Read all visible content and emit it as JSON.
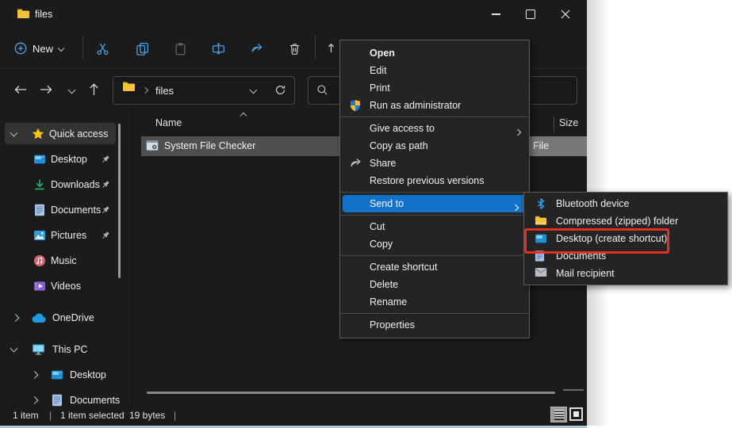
{
  "window": {
    "title": "files"
  },
  "toolbar": {
    "new_label": "New"
  },
  "addressbar": {
    "path_segment": "files"
  },
  "list": {
    "columns": {
      "name": "Name",
      "size": "Size"
    },
    "row": {
      "name": "System File Checker",
      "type": "File"
    }
  },
  "sidebar": {
    "items": [
      {
        "label": "Quick access"
      },
      {
        "label": "Desktop"
      },
      {
        "label": "Downloads"
      },
      {
        "label": "Documents"
      },
      {
        "label": "Pictures"
      },
      {
        "label": "Music"
      },
      {
        "label": "Videos"
      },
      {
        "label": "OneDrive"
      },
      {
        "label": "This PC"
      },
      {
        "label": "Desktop"
      },
      {
        "label": "Documents"
      }
    ]
  },
  "context_menu": {
    "items": [
      {
        "label": "Open"
      },
      {
        "label": "Edit"
      },
      {
        "label": "Print"
      },
      {
        "label": "Run as administrator"
      },
      {
        "label": "Give access to"
      },
      {
        "label": "Copy as path"
      },
      {
        "label": "Share"
      },
      {
        "label": "Restore previous versions"
      },
      {
        "label": "Send to"
      },
      {
        "label": "Cut"
      },
      {
        "label": "Copy"
      },
      {
        "label": "Create shortcut"
      },
      {
        "label": "Delete"
      },
      {
        "label": "Rename"
      },
      {
        "label": "Properties"
      }
    ]
  },
  "send_to_submenu": {
    "items": [
      {
        "label": "Bluetooth device"
      },
      {
        "label": "Compressed (zipped) folder"
      },
      {
        "label": "Desktop (create shortcut)"
      },
      {
        "label": "Documents"
      },
      {
        "label": "Mail recipient"
      }
    ]
  },
  "status_bar": {
    "count": "1 item",
    "separator": "|",
    "selection": "1 item selected",
    "size": "19 bytes"
  },
  "colors": {
    "accent_blue": "#1271c8",
    "annotation_red": "#e33022",
    "selection_gray": "#4f4f4f",
    "icon_accent": "#4ba2e8"
  }
}
